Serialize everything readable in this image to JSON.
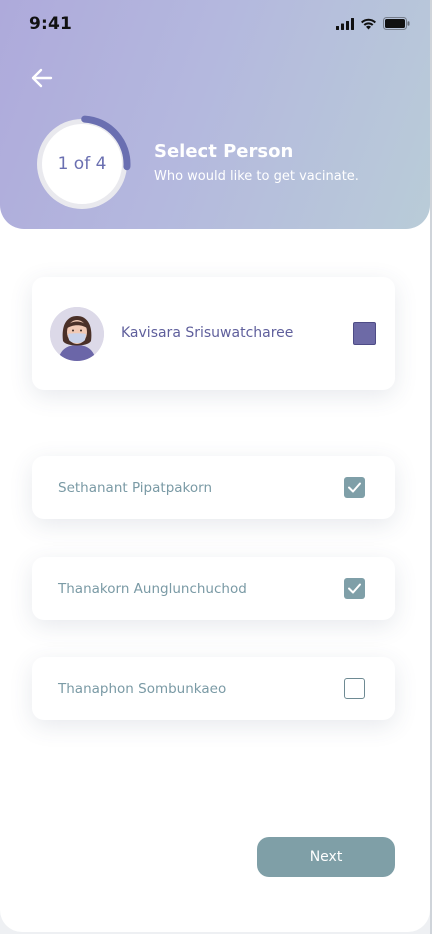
{
  "status_bar": {
    "time": "9:41"
  },
  "header": {
    "progress_label": "1 of 4",
    "progress_fraction": 0.25,
    "title": "Select Person",
    "subtitle": "Who would like to get vacinate."
  },
  "selected_person": {
    "name": "Kavisara Srisuwatcharee",
    "checked": true
  },
  "people": [
    {
      "name": "Sethanant Pipatpakorn",
      "checked": true
    },
    {
      "name": "Thanakorn Aunglunchuchod",
      "checked": true
    },
    {
      "name": "Thanaphon Sombunkaeo",
      "checked": false
    }
  ],
  "next_button": {
    "label": "Next"
  },
  "colors": {
    "accent": "#6a6fb1",
    "checkbox": "#7f9fa8",
    "button": "#7f9fa7"
  }
}
